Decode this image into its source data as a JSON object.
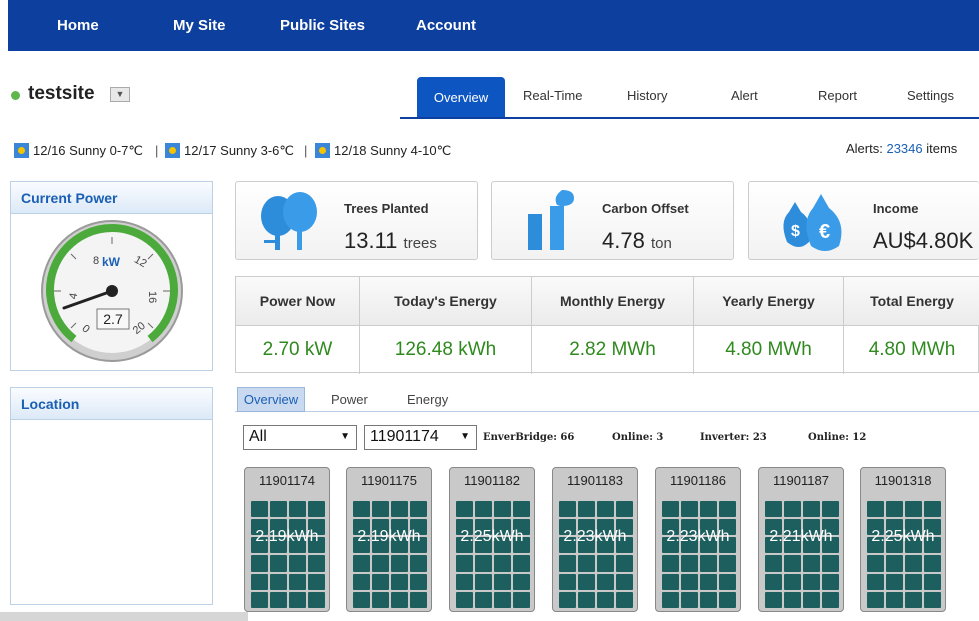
{
  "nav": [
    "Home",
    "My Site",
    "Public Sites",
    "Account"
  ],
  "site": {
    "name": "testsite"
  },
  "tabs": [
    "Overview",
    "Real-Time",
    "History",
    "Alert",
    "Report",
    "Settings"
  ],
  "weather": [
    {
      "text": "12/16 Sunny 0-7℃"
    },
    {
      "text": "12/17 Sunny 3-6℃"
    },
    {
      "text": "12/18 Sunny 4-10℃"
    }
  ],
  "alerts": {
    "label": "Alerts:",
    "count": "23346",
    "unit": "items"
  },
  "current_power": {
    "title": "Current Power",
    "unit": "kW",
    "value": "2.7",
    "ticks": [
      "0",
      "4",
      "8",
      "12",
      "16",
      "20"
    ]
  },
  "location": {
    "title": "Location"
  },
  "cards": [
    {
      "label": "Trees Planted",
      "value": "13.11",
      "unit": "trees"
    },
    {
      "label": "Carbon Offset",
      "value": "4.78",
      "unit": "ton"
    },
    {
      "label": "Income",
      "value": "AU$4.80K",
      "unit": ""
    }
  ],
  "stats": [
    {
      "label": "Power Now",
      "value": "2.70 kW"
    },
    {
      "label": "Today's Energy",
      "value": "126.48 kWh"
    },
    {
      "label": "Monthly Energy",
      "value": "2.82 MWh"
    },
    {
      "label": "Yearly Energy",
      "value": "4.80 MWh"
    },
    {
      "label": "Total Energy",
      "value": "4.80 MWh"
    }
  ],
  "subtabs": [
    "Overview",
    "Power",
    "Energy"
  ],
  "filters": {
    "group": "All",
    "device": "11901174",
    "enverbridge": "EnverBridge: 66",
    "online1": "Online: 3",
    "inverter": "Inverter: 23",
    "online2": "Online: 12"
  },
  "inverters": [
    {
      "id": "11901174",
      "energy": "2.19kWh"
    },
    {
      "id": "11901175",
      "energy": "2.19kWh"
    },
    {
      "id": "11901182",
      "energy": "2.25kWh"
    },
    {
      "id": "11901183",
      "energy": "2.23kWh"
    },
    {
      "id": "11901186",
      "energy": "2.23kWh"
    },
    {
      "id": "11901187",
      "energy": "2.21kWh"
    },
    {
      "id": "11901318",
      "energy": "2.25kWh"
    }
  ],
  "colors": {
    "nav": "#0d3f9e",
    "accent": "#1a5fb4",
    "value_green": "#2f8a1e",
    "panel": "#1c5f5e"
  }
}
